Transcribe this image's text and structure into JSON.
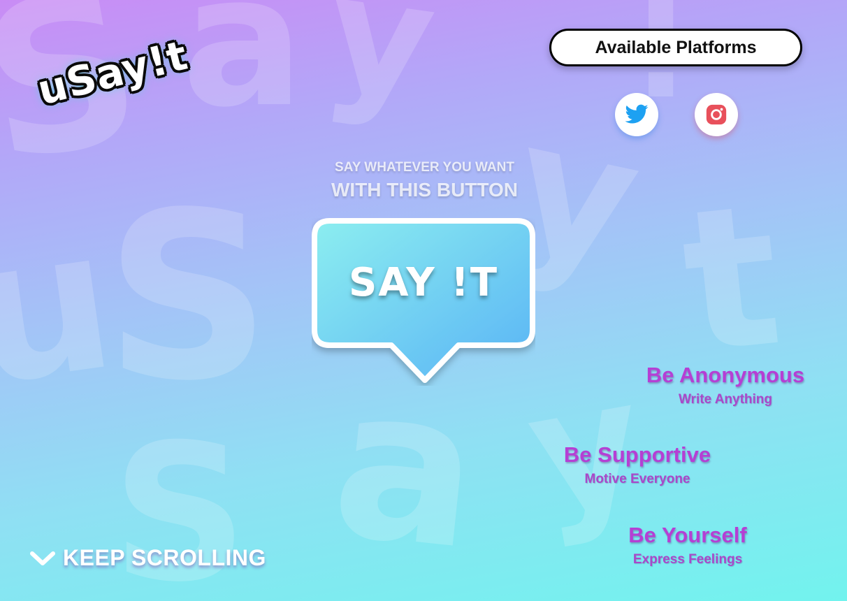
{
  "logo": {
    "text": "uSay!t"
  },
  "platforms": {
    "button_label": "Available Platforms",
    "items": [
      {
        "name": "twitter",
        "icon": "twitter-icon",
        "color": "#1da1f2"
      },
      {
        "name": "instagram",
        "icon": "instagram-icon",
        "color": "#e4405f"
      }
    ]
  },
  "hero": {
    "tagline_line1": "SAY WHATEVER YOU WANT",
    "tagline_line2": "WITH THIS BUTTON",
    "button_label": "SAY !T"
  },
  "features": [
    {
      "title": "Be Anonymous",
      "subtitle": "Write Anything"
    },
    {
      "title": "Be Supportive",
      "subtitle": "Motive Everyone"
    },
    {
      "title": "Be Yourself",
      "subtitle": "Express Feelings"
    }
  ],
  "scroll_hint": {
    "label": "KEEP SCROLLING",
    "icon": "chevron-down-icon"
  },
  "colors": {
    "accent": "#b53fd4",
    "bubble_top": "#8ceef0",
    "bubble_bottom": "#59b3f5"
  }
}
